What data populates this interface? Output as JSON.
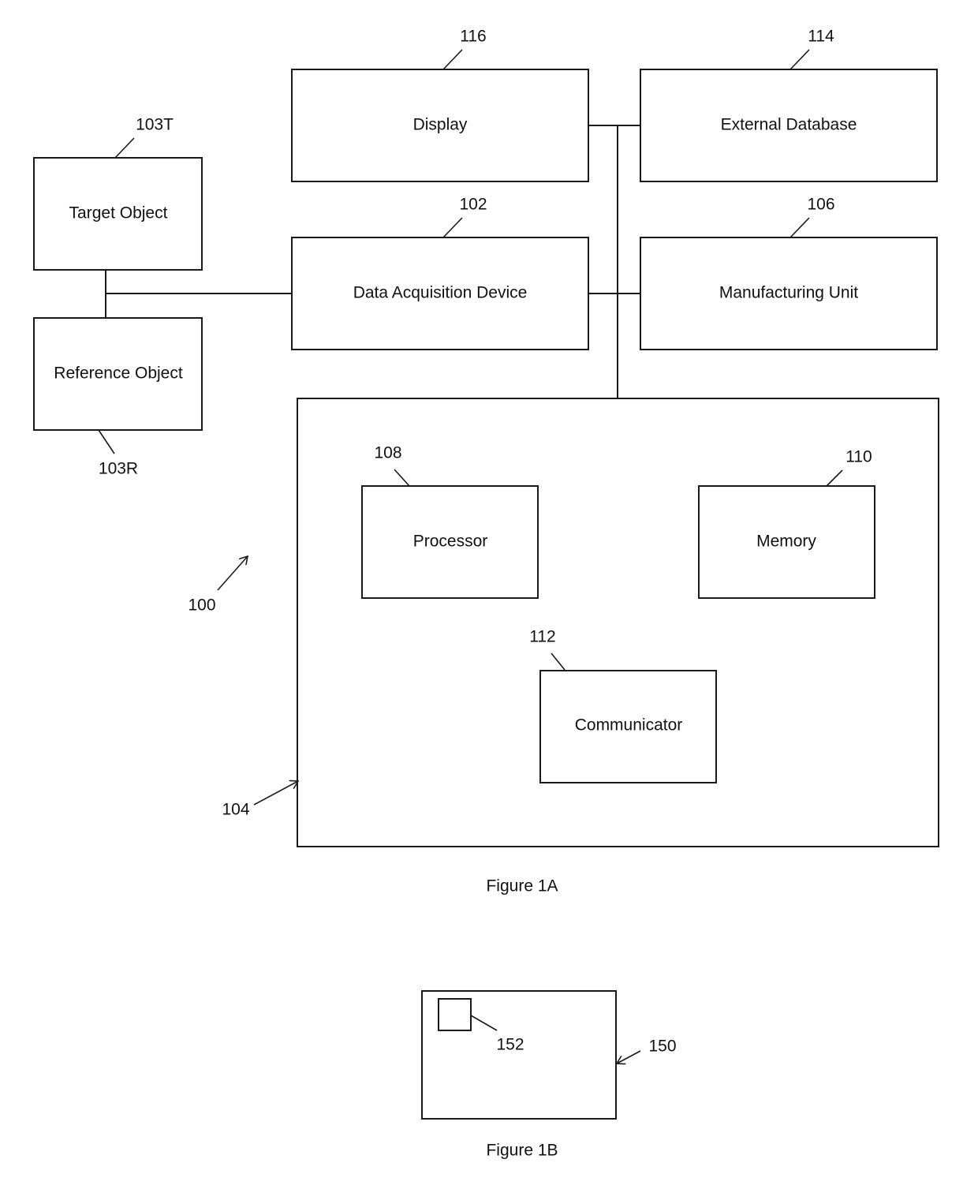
{
  "figure_1a": {
    "caption": "Figure 1A",
    "system_ref": "100",
    "blocks": {
      "display": {
        "label": "Display",
        "ref": "116"
      },
      "external_database": {
        "label": "External Database",
        "ref": "114"
      },
      "target_object": {
        "label": "Target Object",
        "ref": "103T"
      },
      "reference_object": {
        "label": "Reference Object",
        "ref": "103R"
      },
      "data_acquisition_device": {
        "label": "Data Acquisition Device",
        "ref": "102"
      },
      "manufacturing_unit": {
        "label": "Manufacturing Unit",
        "ref": "106"
      },
      "computing_device": {
        "label": "",
        "ref": "104"
      },
      "processor": {
        "label": "Processor",
        "ref": "108"
      },
      "memory": {
        "label": "Memory",
        "ref": "110"
      },
      "communicator": {
        "label": "Communicator",
        "ref": "112"
      }
    }
  },
  "figure_1b": {
    "caption": "Figure 1B",
    "outer_ref": "150",
    "inner_ref": "152"
  }
}
